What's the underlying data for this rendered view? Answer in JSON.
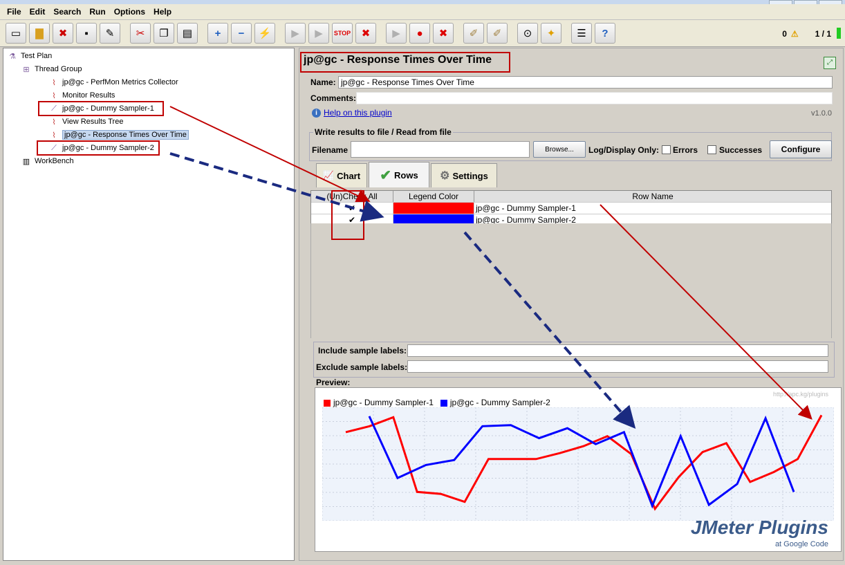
{
  "menubar": {
    "items": [
      "File",
      "Edit",
      "Search",
      "Run",
      "Options",
      "Help"
    ]
  },
  "toolbar": {
    "buttons": [
      "new-icon",
      "open-icon",
      "close-icon",
      "save-icon",
      "save-as-icon",
      "cut-icon",
      "copy-icon",
      "paste-icon",
      "expand-icon",
      "collapse-icon",
      "toggle-icon",
      "start-icon",
      "start-no-pause-icon",
      "stop-icon",
      "shutdown-icon",
      "remote-start-icon",
      "remote-stop-icon",
      "remote-shutdown-icon",
      "clear-icon",
      "clear-all-icon",
      "search-icon",
      "reset-search-icon",
      "function-helper-icon",
      "help-icon"
    ],
    "warning_count": "0",
    "thread_count": "1 / 1"
  },
  "tree": {
    "items": [
      {
        "label": "Test Plan",
        "icon": "flask-icon"
      },
      {
        "label": "Thread Group",
        "icon": "spool-icon"
      },
      {
        "label": "jp@gc - PerfMon Metrics Collector",
        "icon": "graph-icon"
      },
      {
        "label": "Monitor Results",
        "icon": "graph-icon"
      },
      {
        "label": "jp@gc - Dummy Sampler-1",
        "icon": "pipette-icon"
      },
      {
        "label": "View Results Tree",
        "icon": "graph-icon"
      },
      {
        "label": "jp@gc - Response Times Over Time",
        "icon": "graph-icon"
      },
      {
        "label": "jp@gc - Dummy Sampler-2",
        "icon": "pipette-icon"
      },
      {
        "label": "WorkBench",
        "icon": "workbench-icon"
      }
    ]
  },
  "panel": {
    "title": "jp@gc - Response Times Over Time",
    "name_label": "Name:",
    "name_value": "jp@gc - Response Times Over Time",
    "comments_label": "Comments:",
    "help_link": "Help on this plugin",
    "version": "v1.0.0",
    "file_group_title": "Write results to file / Read from file",
    "filename_label": "Filename",
    "browse_label": "Browse...",
    "log_display_label": "Log/Display Only:",
    "errors_label": "Errors",
    "successes_label": "Successes",
    "configure_label": "Configure",
    "tabs": [
      "Chart",
      "Rows",
      "Settings"
    ],
    "table": {
      "headers": [
        "(Un)Check All",
        "Legend Color",
        "Row Name"
      ],
      "rows": [
        {
          "checked": "✔",
          "color": "#ff0000",
          "name": "jp@gc - Dummy Sampler-1"
        },
        {
          "checked": "✔",
          "color": "#0000ff",
          "name": "jp@gc - Dummy Sampler-2"
        }
      ]
    },
    "include_label": "Include sample labels:",
    "exclude_label": "Exclude sample labels:",
    "preview_label": "Preview:",
    "watermark": "http://apc.kg/plugins",
    "logo_main": "JMeter Plugins",
    "logo_sub": "at Google Code"
  },
  "chart_data": {
    "type": "line",
    "series": [
      {
        "name": "jp@gc - Dummy Sampler-1",
        "color": "#ff0000",
        "values": [
          82,
          88,
          97,
          22,
          20,
          12,
          55,
          55,
          55,
          61,
          68,
          78,
          60,
          5,
          37,
          62,
          71,
          32,
          42,
          55,
          99
        ]
      },
      {
        "name": "jp@gc - Dummy Sampler-2",
        "color": "#0000ff",
        "values": [
          98,
          36,
          49,
          54,
          88,
          89,
          76,
          86,
          70,
          82,
          8,
          78,
          9,
          30,
          96,
          22
        ]
      }
    ],
    "grid": true
  }
}
